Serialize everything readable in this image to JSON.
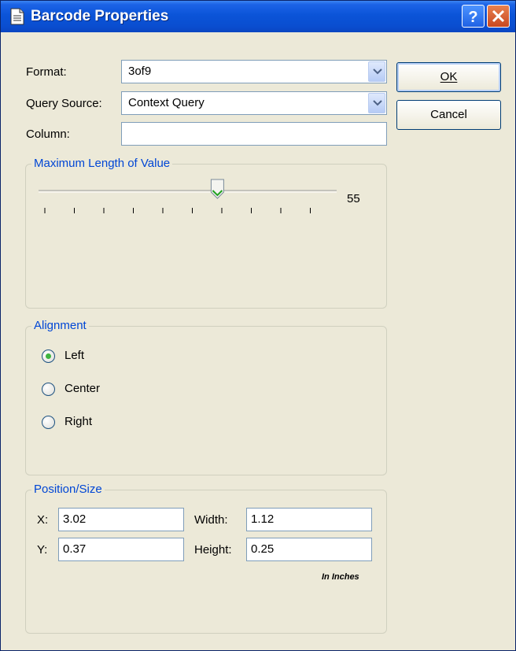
{
  "window": {
    "title": "Barcode Properties"
  },
  "titlebar": {
    "help_label": "?",
    "close_label": "X"
  },
  "form": {
    "format_label": "Format:",
    "format_value": "3of9",
    "query_label": "Query Source:",
    "query_value": "Context Query",
    "column_label": "Column:",
    "column_value": ""
  },
  "buttons": {
    "ok": "OK",
    "cancel": "Cancel"
  },
  "max_length": {
    "title": "Maximum Length of Value",
    "value_label": "55",
    "slider_position_fraction": 0.6
  },
  "alignment": {
    "title": "Alignment",
    "options": [
      "Left",
      "Center",
      "Right"
    ],
    "selected": "Left"
  },
  "position": {
    "title": "Position/Size",
    "x_label": "X:",
    "x_value": "3.02",
    "y_label": "Y:",
    "y_value": "0.37",
    "width_label": "Width:",
    "width_value": "1.12",
    "height_label": "Height:",
    "height_value": "0.25",
    "units": "In Inches"
  }
}
